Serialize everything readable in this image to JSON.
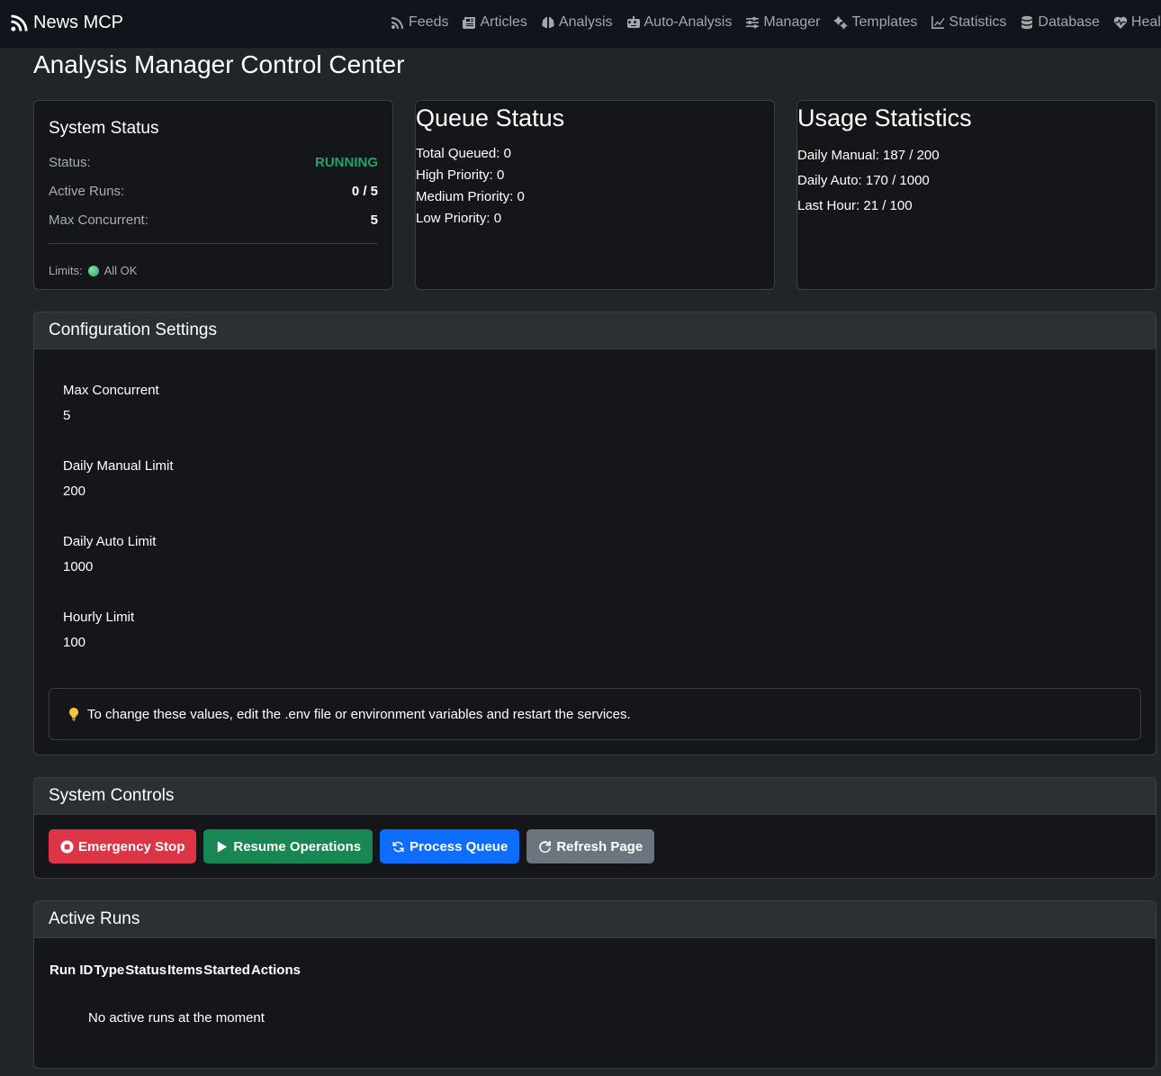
{
  "navbar": {
    "brand": "News MCP",
    "links": [
      {
        "label": "Feeds"
      },
      {
        "label": "Articles"
      },
      {
        "label": "Analysis"
      },
      {
        "label": "Auto-Analysis"
      },
      {
        "label": "Manager"
      },
      {
        "label": "Templates"
      },
      {
        "label": "Statistics"
      },
      {
        "label": "Database"
      },
      {
        "label": "Health"
      }
    ]
  },
  "page": {
    "title": "Analysis Manager Control Center"
  },
  "system_status": {
    "title": "System Status",
    "status_label": "Status:",
    "status_value": "RUNNING",
    "active_runs_label": "Active Runs:",
    "active_runs_value": "0 / 5",
    "max_concurrent_label": "Max Concurrent:",
    "max_concurrent_value": "5",
    "limits_label": "Limits:",
    "limits_value": "All OK",
    "status_color": "#22a36a"
  },
  "queue_status": {
    "title": "Queue Status",
    "lines": [
      "Total Queued: 0",
      "High Priority: 0",
      "Medium Priority: 0",
      "Low Priority: 0"
    ]
  },
  "usage_statistics": {
    "title": "Usage Statistics",
    "lines": [
      "Daily Manual: 187 / 200",
      "Daily Auto: 170 / 1000",
      "Last Hour: 21 / 100"
    ]
  },
  "configuration": {
    "title": "Configuration Settings",
    "items": [
      {
        "label": "Max Concurrent",
        "value": "5"
      },
      {
        "label": "Daily Manual Limit",
        "value": "200"
      },
      {
        "label": "Daily Auto Limit",
        "value": "1000"
      },
      {
        "label": "Hourly Limit",
        "value": "100"
      }
    ],
    "note": "To change these values, edit the .env file or environment variables and restart the services."
  },
  "controls": {
    "title": "System Controls",
    "emergency_stop": "Emergency Stop",
    "resume": "Resume Operations",
    "process_queue": "Process Queue",
    "refresh": "Refresh Page"
  },
  "active_runs": {
    "title": "Active Runs",
    "columns": [
      "Run ID",
      "Type",
      "Status",
      "Items",
      "Started",
      "Actions"
    ],
    "empty_message": "No active runs at the moment"
  },
  "colors": {
    "danger": "#dc3545",
    "success": "#198754",
    "primary": "#0d6efd",
    "secondary": "#6c757d"
  }
}
